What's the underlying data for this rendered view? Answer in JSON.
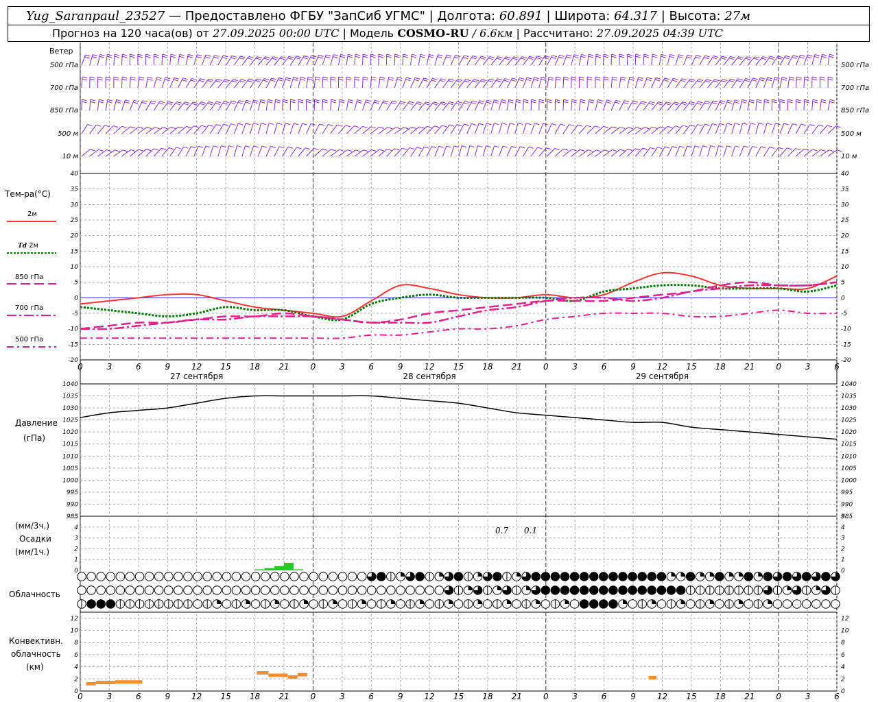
{
  "header": {
    "station": "Yug_Saranpaul_23527",
    "provider": "— Предоставлено ФГБУ \"ЗапСиб УГМС\"",
    "lon_label": "Долгота:",
    "lon_value": "60.891",
    "lat_label": "Широта:",
    "lat_value": "64.317",
    "alt_label": "Высота:",
    "alt_value": "27м",
    "forecast_label": "Прогноз на 120 часа(ов) от",
    "forecast_start": "27.09.2025 00:00 UTC",
    "model_label": "Модель",
    "model_name": "COSMO-RU",
    "model_res": "/ 6.6км",
    "calc_label": "Рассчитано:",
    "calc_time": "27.09.2025 04:39 UTC"
  },
  "labels": {
    "wind": "Ветер",
    "temp": "Тем-ра(°C)",
    "t2m": "2м",
    "td": "Td",
    "td2m": "2м",
    "t850": "850 гПа",
    "t700": "700 гПа",
    "t500": "500 гПа",
    "pressure": "Давление",
    "pressure_unit": "(гПа)",
    "precip_unit3": "(мм/3ч.)",
    "precip": "Осадки",
    "precip_unit1": "(мм/1ч.)",
    "cloud": "Облачность",
    "conv1": "Конвективн.",
    "conv2": "облачность",
    "conv3": "(км)",
    "precip_val1": "0.7",
    "precip_val2": "0.1"
  },
  "wind_levels": [
    "500 гПа",
    "700 гПа",
    "850 гПа",
    "500 м",
    "10 м"
  ],
  "dates": [
    "27 сентября",
    "28 сентября",
    "29 сентября"
  ],
  "x_hours": [
    "0",
    "3",
    "6",
    "9",
    "12",
    "15",
    "18",
    "21",
    "0",
    "3",
    "6",
    "9",
    "12",
    "15",
    "18",
    "21",
    "0",
    "3",
    "6",
    "9",
    "12",
    "15",
    "18",
    "21",
    "0",
    "3",
    "6"
  ],
  "colors": {
    "t2m": "#ff3333",
    "td": "#007700",
    "t850": "#e0208c",
    "wind": "#8a2be2",
    "pressure": "#000000",
    "precip": "#22cc22",
    "conv": "#ff8c28",
    "zero_line": "#3333cc"
  },
  "chart_data": [
    {
      "type": "line",
      "name": "temperature",
      "ylim": [
        -20,
        40
      ],
      "x_hours": [
        0,
        3,
        6,
        9,
        12,
        15,
        18,
        21,
        24,
        27,
        30,
        33,
        36,
        39,
        42,
        45,
        48,
        51,
        54,
        57,
        60,
        63,
        66,
        69,
        72,
        75,
        78
      ],
      "series": [
        {
          "name": "2м",
          "values": [
            -2,
            -1,
            0,
            1,
            1,
            -1,
            -3,
            -4,
            -5,
            -6,
            -1,
            4,
            3,
            1,
            0,
            0,
            1,
            0,
            1,
            5,
            8,
            7,
            4,
            3,
            3,
            3,
            7
          ]
        },
        {
          "name": "Td 2м",
          "values": [
            -3,
            -4,
            -5,
            -6,
            -5,
            -3,
            -4,
            -4,
            -6,
            -7,
            -2,
            0,
            1,
            0,
            0,
            0,
            0,
            -1,
            2,
            3,
            4,
            4,
            3,
            3,
            3,
            2,
            4
          ]
        },
        {
          "name": "850 гПа",
          "values": [
            -10,
            -9,
            -8,
            -8,
            -7,
            -6,
            -6,
            -5,
            -6,
            -7,
            -8,
            -7,
            -5,
            -4,
            -3,
            -2,
            -1,
            -1,
            -1,
            0,
            1,
            2,
            4,
            5,
            4,
            4,
            5
          ]
        },
        {
          "name": "700 гПа",
          "values": [
            -10,
            -10,
            -9,
            -8,
            -7,
            -7,
            -6,
            -6,
            -6,
            -7,
            -8,
            -8,
            -8,
            -6,
            -4,
            -3,
            -1,
            0,
            0,
            -1,
            0,
            2,
            3,
            4,
            4,
            4,
            5
          ]
        },
        {
          "name": "500 гПа",
          "values": [
            -13,
            -13,
            -13,
            -13,
            -13,
            -13,
            -13,
            -13,
            -13,
            -13,
            -12,
            -12,
            -11,
            -10,
            -10,
            -9,
            -7,
            -6,
            -5,
            -5,
            -5,
            -6,
            -6,
            -5,
            -4,
            -5,
            -5
          ]
        }
      ]
    },
    {
      "type": "line",
      "name": "pressure",
      "ylim": [
        985,
        1040
      ],
      "x_hours": [
        0,
        3,
        6,
        9,
        12,
        15,
        18,
        21,
        24,
        27,
        30,
        33,
        36,
        39,
        42,
        45,
        48,
        51,
        54,
        57,
        60,
        63,
        66,
        69,
        72,
        75,
        78
      ],
      "series": [
        {
          "values": [
            1026,
            1028,
            1029,
            1030,
            1032,
            1034,
            1035,
            1035,
            1035,
            1035,
            1035,
            1034,
            1033,
            1032,
            1030,
            1028,
            1027,
            1026,
            1025,
            1024,
            1024,
            1022,
            1021,
            1020,
            1019,
            1018,
            1017
          ]
        }
      ]
    },
    {
      "type": "bar",
      "name": "precipitation",
      "ylim": [
        0,
        5
      ],
      "x_hours": [
        18,
        19,
        20,
        21,
        22
      ],
      "values": [
        0.1,
        0.2,
        0.4,
        0.7,
        0.1
      ]
    },
    {
      "type": "bar",
      "name": "convective_cloud",
      "ylim": [
        0,
        13
      ],
      "segments": [
        {
          "from": 0.6,
          "to": 1.6,
          "value": 1.2
        },
        {
          "from": 1.6,
          "to": 3.6,
          "value": 1.4
        },
        {
          "from": 3.6,
          "to": 6.4,
          "value": 1.5
        },
        {
          "from": 18.2,
          "to": 19.4,
          "value": 3.0
        },
        {
          "from": 19.4,
          "to": 21.4,
          "value": 2.6
        },
        {
          "from": 21.4,
          "to": 22.4,
          "value": 2.3
        },
        {
          "from": 22.4,
          "to": 23.4,
          "value": 2.7
        },
        {
          "from": 58.6,
          "to": 59.4,
          "value": 2.2
        }
      ]
    }
  ]
}
